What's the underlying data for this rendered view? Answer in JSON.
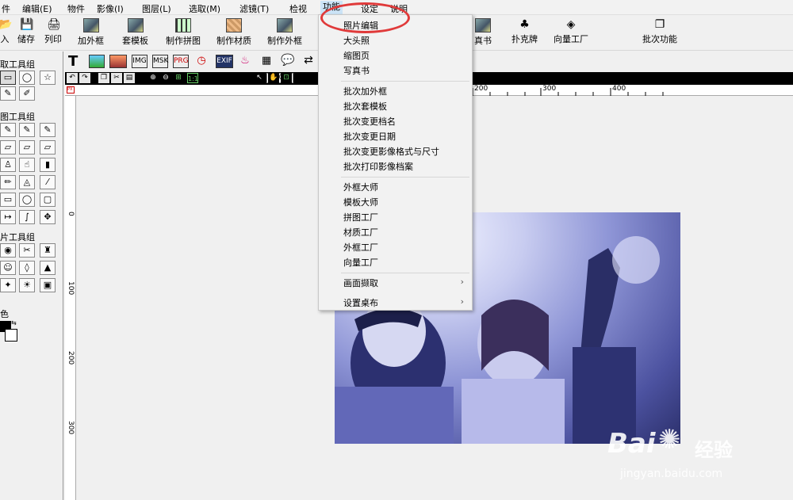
{
  "menubar": [
    {
      "label": "件"
    },
    {
      "label": "编辑(E)"
    },
    {
      "label": "物件"
    },
    {
      "label": "影像(I)"
    },
    {
      "label": "图层(L)"
    },
    {
      "label": "选取(M)"
    },
    {
      "label": "滤镜(T)"
    },
    {
      "label": "检视"
    },
    {
      "label": "功能"
    },
    {
      "label": "设定"
    },
    {
      "label": "说明"
    }
  ],
  "toolbar": [
    {
      "label": "入"
    },
    {
      "label": "储存"
    },
    {
      "label": "列印"
    },
    {
      "label": "加外框"
    },
    {
      "label": "套模板"
    },
    {
      "label": "制作拼图"
    },
    {
      "label": "制作材质"
    },
    {
      "label": "制作外框"
    },
    {
      "label": "真书"
    },
    {
      "label": "扑克牌"
    },
    {
      "label": "向量工厂"
    },
    {
      "label": "批次功能"
    }
  ],
  "left_panel": {
    "group1": "取工具组",
    "group2": "图工具组",
    "group3": "片工具组",
    "color": "色"
  },
  "sec_toolbar": {
    "icons": [
      "T",
      "",
      "",
      "IMG",
      "MSK",
      "PRG",
      "",
      "EXIF",
      "",
      "",
      "",
      ""
    ]
  },
  "blackbar": {
    "zoom": "100%"
  },
  "hruler": {
    "labels": [
      "200",
      "300",
      "400"
    ]
  },
  "vruler": {
    "labels": [
      "0",
      "100",
      "200",
      "300"
    ]
  },
  "dropdown": {
    "items": [
      "照片编辑",
      "大头照",
      "缩图页",
      "写真书",
      "批次加外框",
      "批次套模板",
      "批次变更档名",
      "批次变更日期",
      "批次变更影像格式与尺寸",
      "批次打印影像档案",
      "外框大师",
      "模板大师",
      "拼图工厂",
      "材质工厂",
      "外框工厂",
      "向量工厂",
      "画面撷取",
      "设置桌布"
    ]
  },
  "watermark": {
    "brand": "Bai",
    "brand2": "经验",
    "url": "jingyan.baidu.com"
  },
  "colors": {
    "highlight": "#cce4f7",
    "annotation": "#e03a3a"
  }
}
